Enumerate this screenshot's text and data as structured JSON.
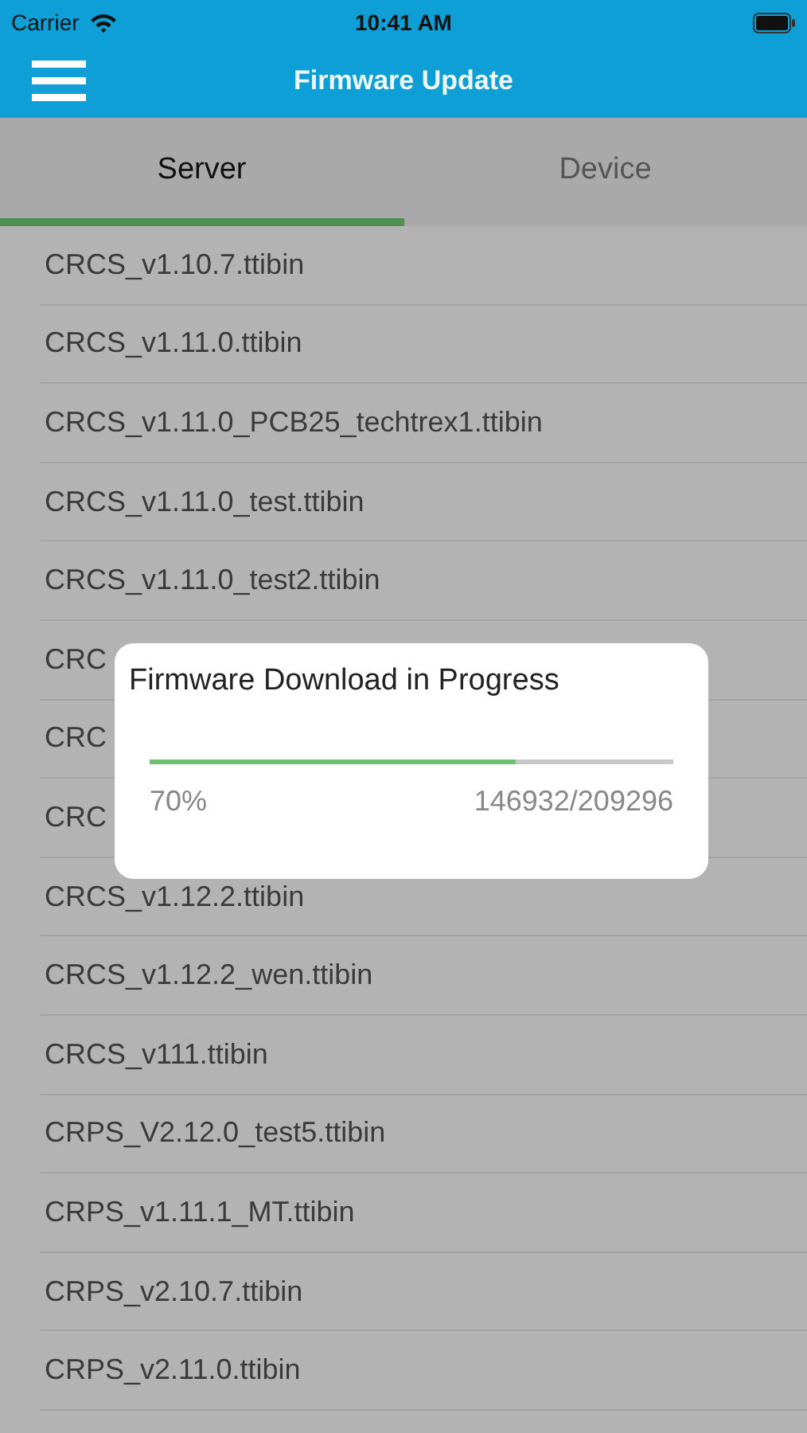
{
  "status_bar": {
    "carrier": "Carrier",
    "time": "10:41 AM"
  },
  "nav_bar": {
    "title": "Firmware Update"
  },
  "tabs": [
    {
      "label": "Server",
      "selected": true
    },
    {
      "label": "Device",
      "selected": false
    }
  ],
  "files": [
    "CRCS_v1.10.7.ttibin",
    "CRCS_v1.11.0.ttibin",
    "CRCS_v1.11.0_PCB25_techtrex1.ttibin",
    "CRCS_v1.11.0_test.ttibin",
    "CRCS_v1.11.0_test2.ttibin",
    "CRC",
    "CRC",
    "CRC",
    "CRCS_v1.12.2.ttibin",
    "CRCS_v1.12.2_wen.ttibin",
    "CRCS_v111.ttibin",
    "CRPS_V2.12.0_test5.ttibin",
    "CRPS_v1.11.1_MT.ttibin",
    "CRPS_v2.10.7.ttibin",
    "CRPS_v2.11.0.ttibin"
  ],
  "dialog": {
    "title": "Firmware Download in Progress",
    "level": 0.7,
    "percent": "70%",
    "bytes": "146932/209296"
  }
}
